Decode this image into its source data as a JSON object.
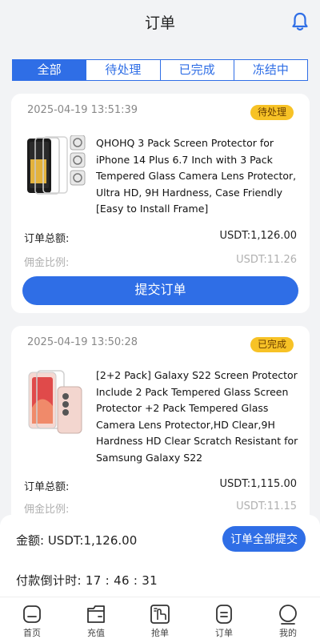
{
  "header": {
    "title": "订单",
    "icon": "bell-icon"
  },
  "tabs": [
    {
      "label": "全部",
      "active": true
    },
    {
      "label": "待处理",
      "active": false
    },
    {
      "label": "已完成",
      "active": false
    },
    {
      "label": "冻结中",
      "active": false
    }
  ],
  "orders": [
    {
      "time": "2025-04-19 13:51:39",
      "status": "待处理",
      "name": "QHOHQ 3 Pack Screen Protector for iPhone 14 Plus 6.7 Inch with 3 Pack Tempered Glass Camera Lens Protector, Ultra HD, 9H Hardness, Case Friendly [Easy to Install Frame]",
      "total_label": "订单总额:",
      "total_value": "USDT:1,126.00",
      "commission_label": "佣金比例:",
      "commission_value": "USDT:11.26",
      "submit_label": "提交订单"
    },
    {
      "time": "2025-04-19 13:50:28",
      "status": "已完成",
      "name": "[2+2 Pack] Galaxy S22 Screen Protector Include 2 Pack Tempered Glass Screen Protector +2 Pack Tempered Glass Camera Lens Protector,HD Clear,9H Hardness HD Clear Scratch Resistant for Samsung Galaxy S22",
      "total_label": "订单总额:",
      "total_value": "USDT:1,115.00",
      "commission_label": "佣金比例:",
      "commission_value": "USDT:11.15"
    }
  ],
  "summary": {
    "amount": "金额: USDT:1,126.00",
    "submit_all_label": "订单全部提交",
    "countdown": "付款倒计时: 17 : 46 : 31"
  },
  "nav": [
    {
      "label": "首页",
      "icon": "home-icon"
    },
    {
      "label": "充值",
      "icon": "wallet-icon"
    },
    {
      "label": "抢单",
      "icon": "grab-order-icon"
    },
    {
      "label": "订单",
      "icon": "order-icon"
    },
    {
      "label": "我的",
      "icon": "profile-icon"
    }
  ],
  "colors": {
    "primary": "#2f6ee6",
    "badge": "#f7c226"
  }
}
